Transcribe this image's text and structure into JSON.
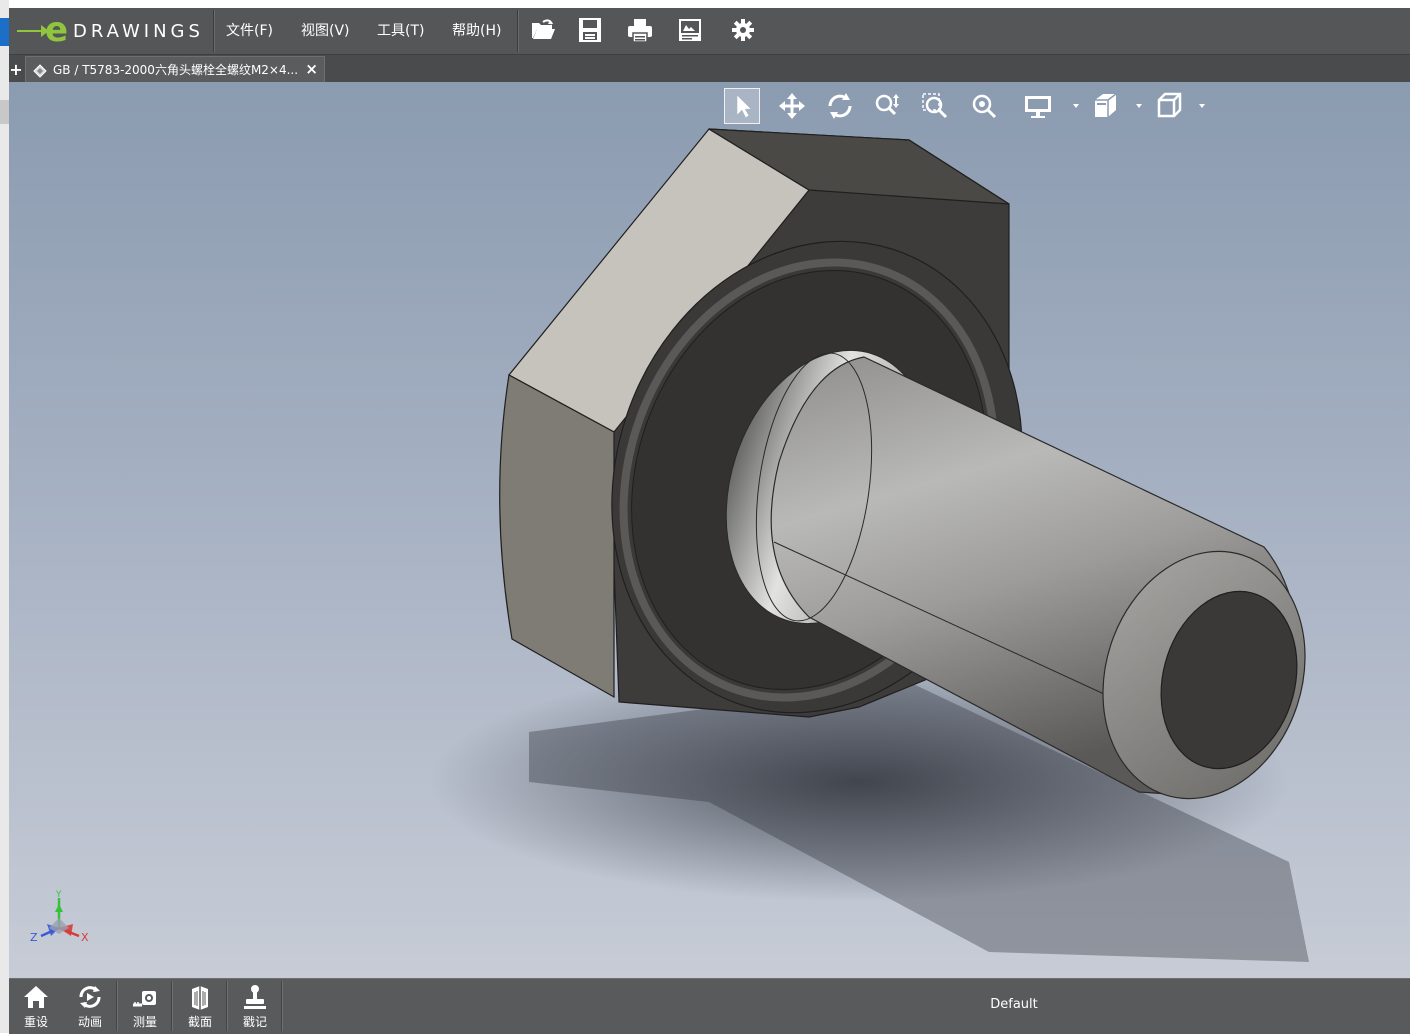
{
  "app": {
    "logo_text": "DRAWINGS",
    "logo_letter": "e"
  },
  "menu": {
    "items": [
      "文件(F)",
      "视图(V)",
      "工具(T)",
      "帮助(H)"
    ]
  },
  "toolbar_icons": [
    "open-folder-icon",
    "save-icon",
    "print-icon",
    "document-properties-icon",
    "gear-icon"
  ],
  "tabs": [
    {
      "title": "GB / T5783-2000六角头螺栓全螺纹M2×4...",
      "close": "×"
    }
  ],
  "new_tab": "+",
  "view_toolbar": [
    "select-icon",
    "pan-icon",
    "rotate-icon",
    "zoom-icon",
    "zoom-to-area-icon",
    "zoom-to-fit-icon",
    "display-style-icon",
    "view-orientation-icon",
    "standard-views-icon"
  ],
  "triad": {
    "x": "X",
    "y": "Y",
    "z": "Z"
  },
  "bottom_bar": {
    "buttons": [
      {
        "label": "重设",
        "icon": "home-icon"
      },
      {
        "label": "动画",
        "icon": "animate-icon"
      },
      {
        "label": "测量",
        "icon": "measure-icon"
      },
      {
        "label": "截面",
        "icon": "section-icon"
      },
      {
        "label": "戳记",
        "icon": "stamp-icon"
      }
    ],
    "configuration": "Default"
  },
  "colors": {
    "menubar": "#555657",
    "accent_green": "#8fc63e",
    "viewport_top": "#8b9bb0",
    "viewport_bottom": "#c7ccd6"
  }
}
